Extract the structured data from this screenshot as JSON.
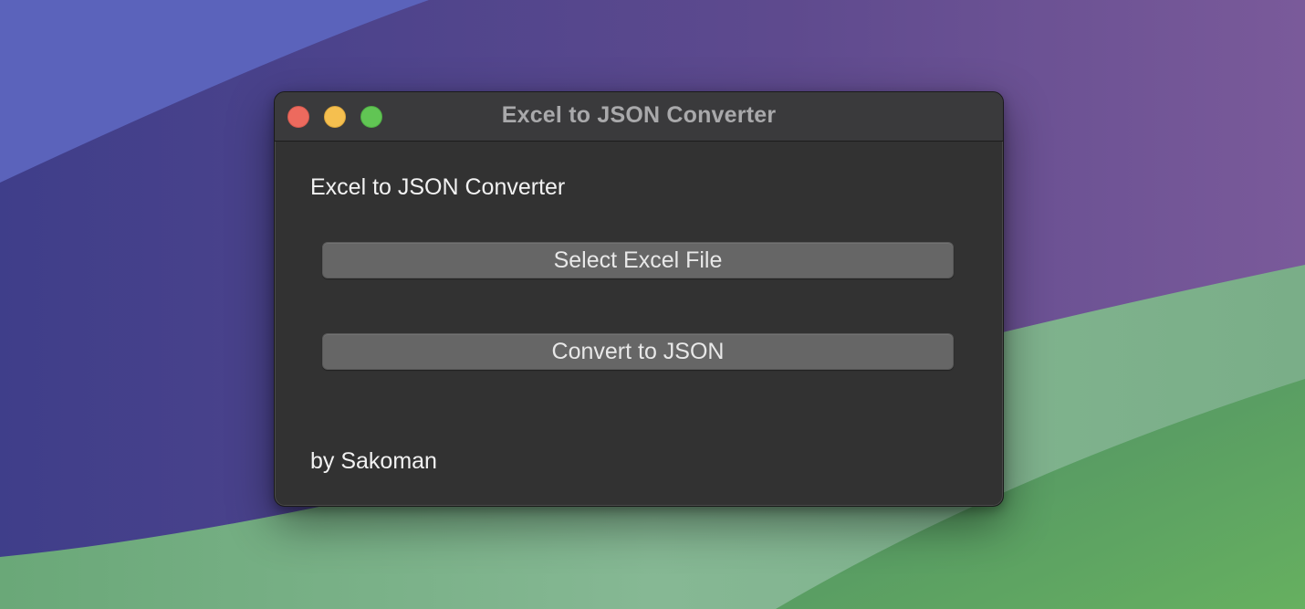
{
  "window": {
    "title": "Excel to JSON Converter"
  },
  "app": {
    "heading": "Excel to JSON Converter",
    "select_button": "Select Excel File",
    "convert_button": "Convert to JSON",
    "credit": "by Sakoman"
  },
  "colors": {
    "close": "#ed6a5e",
    "minimize": "#f5bf4f",
    "zoom": "#61c554",
    "window_bg": "#323232",
    "button_bg": "#666666"
  }
}
